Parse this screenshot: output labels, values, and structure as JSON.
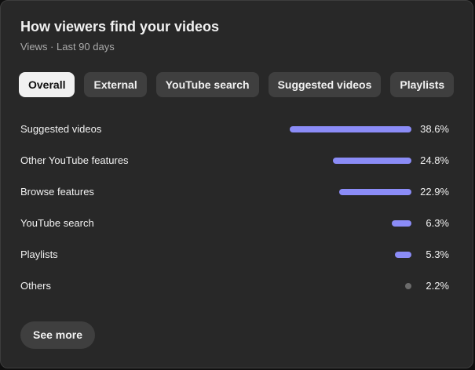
{
  "card": {
    "title": "How viewers find your videos",
    "subtitle": "Views · Last 90 days"
  },
  "tabs": [
    {
      "label": "Overall",
      "active": true
    },
    {
      "label": "External",
      "active": false
    },
    {
      "label": "YouTube search",
      "active": false
    },
    {
      "label": "Suggested videos",
      "active": false
    },
    {
      "label": "Playlists",
      "active": false
    }
  ],
  "sources": [
    {
      "label": "Suggested videos",
      "value": 38.6,
      "value_text": "38.6%"
    },
    {
      "label": "Other YouTube features",
      "value": 24.8,
      "value_text": "24.8%"
    },
    {
      "label": "Browse features",
      "value": 22.9,
      "value_text": "22.9%"
    },
    {
      "label": "YouTube search",
      "value": 6.3,
      "value_text": "6.3%"
    },
    {
      "label": "Playlists",
      "value": 5.3,
      "value_text": "5.3%"
    },
    {
      "label": "Others",
      "value": 2.2,
      "value_text": "2.2%"
    }
  ],
  "colors": {
    "bar": "#8b8cf7",
    "bar_minor": "#6b6b6b"
  },
  "see_more_label": "See more"
}
